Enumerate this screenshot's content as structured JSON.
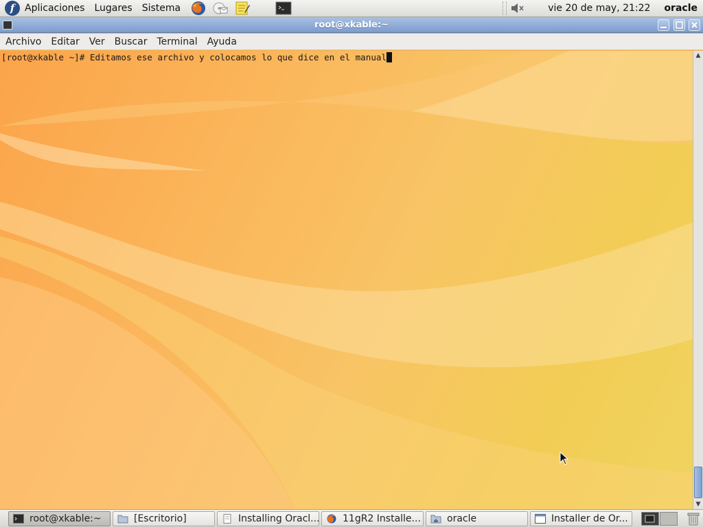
{
  "top_panel": {
    "menus": [
      "Aplicaciones",
      "Lugares",
      "Sistema"
    ],
    "launchers": [
      "firefox-icon",
      "mail-icon",
      "notes-icon",
      "terminal-icon"
    ],
    "clock": "vie 20 de may, 21:22",
    "user": "oracle"
  },
  "window": {
    "title": "root@xkable:~",
    "buttons": {
      "minimize": "minimize-icon",
      "maximize": "maximize-icon",
      "close": "close-icon"
    }
  },
  "menubar": {
    "items": [
      "Archivo",
      "Editar",
      "Ver",
      "Buscar",
      "Terminal",
      "Ayuda"
    ]
  },
  "terminal": {
    "line": "[root@xkable ~]# Editamos ese archivo y colocamos lo que dice en el manual"
  },
  "taskbar": {
    "tasks": [
      {
        "label": "root@xkable:~",
        "icon": "terminal-icon",
        "active": true
      },
      {
        "label": "[Escritorio]",
        "icon": "folder-icon",
        "active": false
      },
      {
        "label": "Installing Oracl...",
        "icon": "document-icon",
        "active": false
      },
      {
        "label": "11gR2 Installe...",
        "icon": "firefox-icon",
        "active": false
      },
      {
        "label": "oracle",
        "icon": "home-folder-icon",
        "active": false
      },
      {
        "label": "Installer de Or...",
        "icon": "window-icon",
        "active": false
      }
    ]
  },
  "colors": {
    "titlebar": "#8aa7d4",
    "wallpaper_orange": "#fba44a",
    "wallpaper_yellow": "#f0d460"
  }
}
